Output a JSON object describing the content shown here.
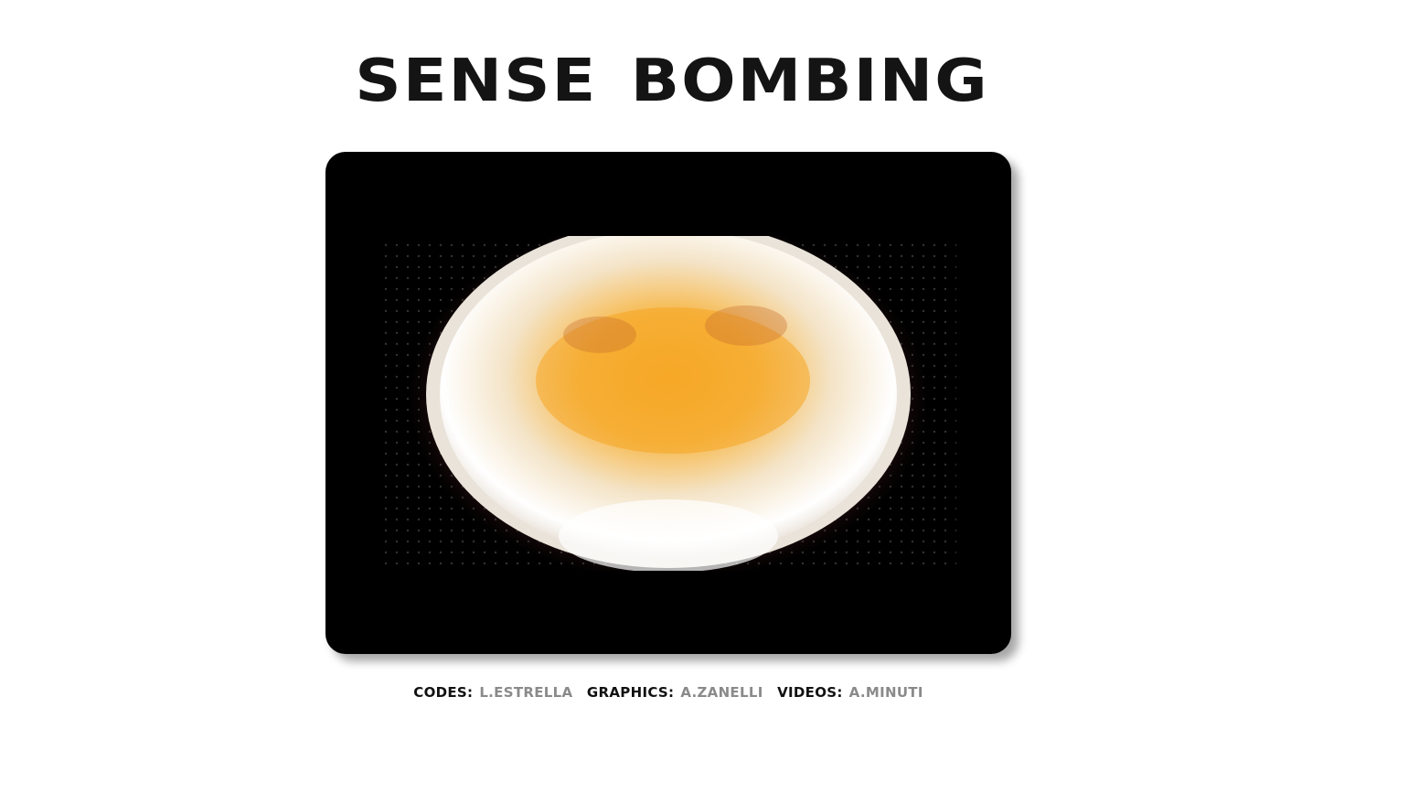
{
  "page": {
    "title": "SENSE BOMBING"
  },
  "video": {
    "description_icon": "video-frame-explosion",
    "colors": {
      "background": "#000000",
      "core": "#f5a623",
      "glow": "#ffffff",
      "rim": "#6b2f2f"
    }
  },
  "credits": [
    {
      "label": "CODES:",
      "name": "L.ESTRELLA"
    },
    {
      "label": "GRAPHICS:",
      "name": "A.ZANELLI"
    },
    {
      "label": "VIDEOS:",
      "name": "A.MINUTI"
    }
  ],
  "colors": {
    "label": "#111111",
    "name": "#8a8a8a"
  }
}
